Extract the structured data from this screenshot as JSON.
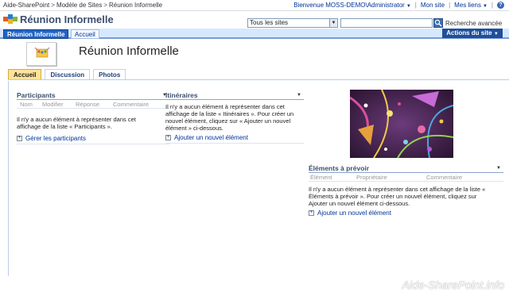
{
  "breadcrumb": [
    "Aide-SharePoint",
    "Modèle de Sites",
    "Réunion Informelle"
  ],
  "topright": {
    "welcome": "Bienvenue MOSS-DEMO\\Administrator",
    "my_site": "Mon site",
    "my_links": "Mes liens"
  },
  "site_title": "Réunion Informelle",
  "search": {
    "scope": "Tous les sites",
    "value": "",
    "advanced": "Recherche avancée"
  },
  "nav": {
    "tabs": [
      "Réunion Informelle",
      "Accueil"
    ],
    "actions": "Actions du site"
  },
  "page_title": "Réunion Informelle",
  "page_tabs": [
    "Accueil",
    "Discussion",
    "Photos"
  ],
  "participants": {
    "title": "Participants",
    "columns": [
      "Nom",
      "Modifier",
      "Réponse",
      "Commentaire"
    ],
    "empty_text": "Il n'y a aucun élément à représenter dans cet affichage de la liste « Participants ».",
    "link": "Gérer les participants"
  },
  "itineraires": {
    "title": "Itinéraires",
    "empty_text": "Il n'y a aucun élément à représenter dans cet affichage de la liste « Itinéraires ». Pour créer un nouvel élément, cliquez sur « Ajouter un nouvel élément » ci-dessous.",
    "link": "Ajouter un nouvel élément"
  },
  "elements": {
    "title": "Éléments à prévoir",
    "columns": [
      "Élément",
      "Propriétaire",
      "Commentaire"
    ],
    "empty_text": "Il n'y a aucun élément à représenter dans cet affichage de la liste « Éléments à prévoir ». Pour créer un nouvel élément, cliquez sur Ajouter un nouvel élément ci-dessous.",
    "link": "Ajouter un nouvel élément"
  },
  "watermark": "Aide-SharePoint.info",
  "colors": {
    "nav_active": "#1f63c5",
    "nav_bg": "#d6e8ff",
    "tab_active": "#ffe39a",
    "link": "#003399",
    "title": "#3b4f70"
  }
}
